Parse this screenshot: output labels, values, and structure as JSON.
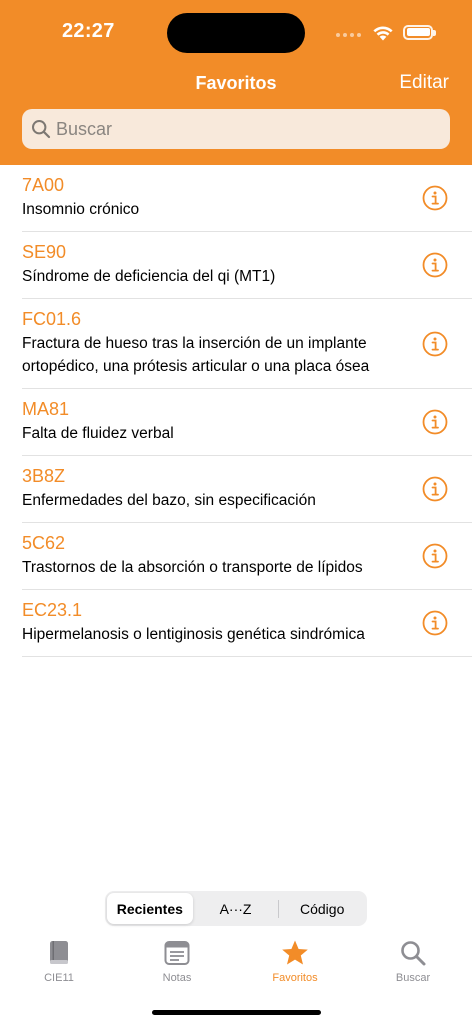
{
  "status": {
    "time": "22:27"
  },
  "nav": {
    "title": "Favoritos",
    "edit_label": "Editar"
  },
  "search": {
    "placeholder": "Buscar"
  },
  "colors": {
    "accent": "#F28C28",
    "search_bg": "#F8E9DB",
    "tab_inactive": "#8e8e93"
  },
  "items": [
    {
      "code": "7A00",
      "desc": "Insomnio crónico"
    },
    {
      "code": "SE90",
      "desc": "Síndrome de deficiencia del qi (MT1)"
    },
    {
      "code": "FC01.6",
      "desc": "Fractura de hueso tras la inserción de un implante ortopédico, una prótesis articular o una placa ósea"
    },
    {
      "code": "MA81",
      "desc": "Falta de fluidez verbal"
    },
    {
      "code": "3B8Z",
      "desc": "Enfermedades del bazo, sin especificación"
    },
    {
      "code": "5C62",
      "desc": "Trastornos de la absorción o transporte de lípidos"
    },
    {
      "code": "EC23.1",
      "desc": "Hipermelanosis o lentiginosis genética sindrómica"
    }
  ],
  "segments": [
    {
      "label": "Recientes",
      "selected": true
    },
    {
      "label": "A···Z",
      "selected": false
    },
    {
      "label": "Código",
      "selected": false
    }
  ],
  "tabs": [
    {
      "label": "CIE11",
      "icon": "book-icon",
      "active": false
    },
    {
      "label": "Notas",
      "icon": "notes-icon",
      "active": false
    },
    {
      "label": "Favoritos",
      "icon": "star-icon",
      "active": true
    },
    {
      "label": "Buscar",
      "icon": "search-icon",
      "active": false
    }
  ]
}
